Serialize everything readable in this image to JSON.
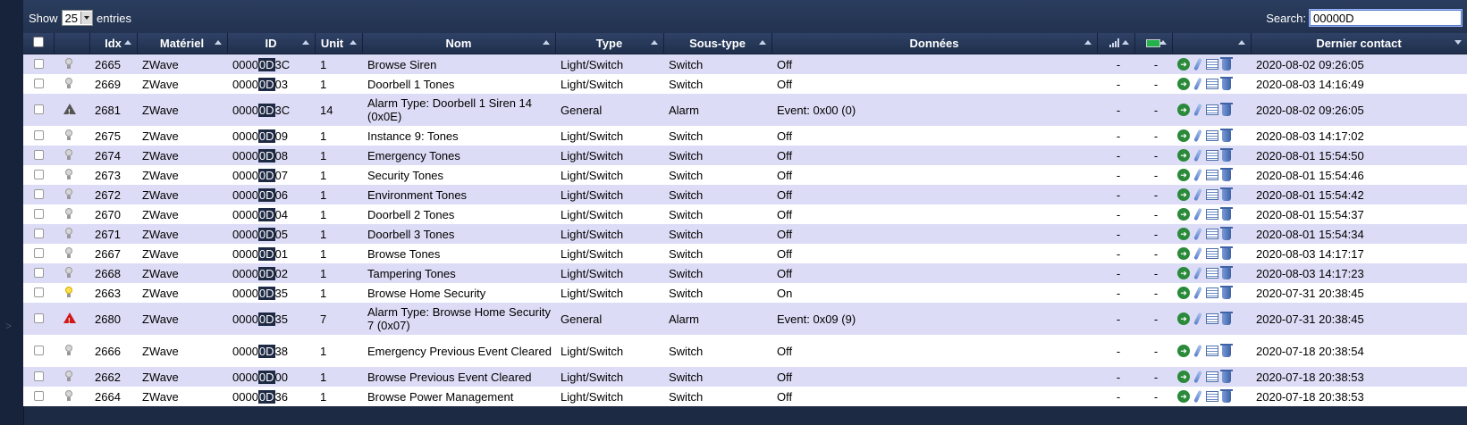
{
  "top": {
    "show_label": "Show",
    "entries_value": "25",
    "entries_label": "entries",
    "search_label": "Search:",
    "search_value": "00000D"
  },
  "columns": {
    "idx": "Idx",
    "materiel": "Matériel",
    "id": "ID",
    "unit": "Unit",
    "nom": "Nom",
    "type": "Type",
    "soustype": "Sous-type",
    "donnees": "Données",
    "dernier": "Dernier contact"
  },
  "rows": [
    {
      "idx": "2665",
      "hw": "ZWave",
      "id_pre": "0000",
      "id_hl": "0D",
      "id_post": "3C",
      "unit": "1",
      "nom": "Browse Siren",
      "type": "Light/Switch",
      "sub": "Switch",
      "data": "Off",
      "sig": "-",
      "bat": "-",
      "last": "2020-08-02 09:26:05",
      "icon": "bulb"
    },
    {
      "idx": "2669",
      "hw": "ZWave",
      "id_pre": "0000",
      "id_hl": "0D",
      "id_post": "03",
      "unit": "1",
      "nom": "Doorbell 1 Tones",
      "type": "Light/Switch",
      "sub": "Switch",
      "data": "Off",
      "sig": "-",
      "bat": "-",
      "last": "2020-08-03 14:16:49",
      "icon": "bulb"
    },
    {
      "idx": "2681",
      "hw": "ZWave",
      "id_pre": "0000",
      "id_hl": "0D",
      "id_post": "3C",
      "unit": "14",
      "nom": "Alarm Type: Doorbell 1 Siren 14 (0x0E)",
      "type": "General",
      "sub": "Alarm",
      "data": "Event: 0x00 (0)",
      "sig": "-",
      "bat": "-",
      "last": "2020-08-02 09:26:05",
      "icon": "alarm-grey"
    },
    {
      "idx": "2675",
      "hw": "ZWave",
      "id_pre": "0000",
      "id_hl": "0D",
      "id_post": "09",
      "unit": "1",
      "nom": "Instance 9: Tones",
      "type": "Light/Switch",
      "sub": "Switch",
      "data": "Off",
      "sig": "-",
      "bat": "-",
      "last": "2020-08-03 14:17:02",
      "icon": "bulb"
    },
    {
      "idx": "2674",
      "hw": "ZWave",
      "id_pre": "0000",
      "id_hl": "0D",
      "id_post": "08",
      "unit": "1",
      "nom": "Emergency Tones",
      "type": "Light/Switch",
      "sub": "Switch",
      "data": "Off",
      "sig": "-",
      "bat": "-",
      "last": "2020-08-01 15:54:50",
      "icon": "bulb"
    },
    {
      "idx": "2673",
      "hw": "ZWave",
      "id_pre": "0000",
      "id_hl": "0D",
      "id_post": "07",
      "unit": "1",
      "nom": "Security Tones",
      "type": "Light/Switch",
      "sub": "Switch",
      "data": "Off",
      "sig": "-",
      "bat": "-",
      "last": "2020-08-01 15:54:46",
      "icon": "bulb"
    },
    {
      "idx": "2672",
      "hw": "ZWave",
      "id_pre": "0000",
      "id_hl": "0D",
      "id_post": "06",
      "unit": "1",
      "nom": "Environment Tones",
      "type": "Light/Switch",
      "sub": "Switch",
      "data": "Off",
      "sig": "-",
      "bat": "-",
      "last": "2020-08-01 15:54:42",
      "icon": "bulb"
    },
    {
      "idx": "2670",
      "hw": "ZWave",
      "id_pre": "0000",
      "id_hl": "0D",
      "id_post": "04",
      "unit": "1",
      "nom": "Doorbell 2 Tones",
      "type": "Light/Switch",
      "sub": "Switch",
      "data": "Off",
      "sig": "-",
      "bat": "-",
      "last": "2020-08-01 15:54:37",
      "icon": "bulb"
    },
    {
      "idx": "2671",
      "hw": "ZWave",
      "id_pre": "0000",
      "id_hl": "0D",
      "id_post": "05",
      "unit": "1",
      "nom": "Doorbell 3 Tones",
      "type": "Light/Switch",
      "sub": "Switch",
      "data": "Off",
      "sig": "-",
      "bat": "-",
      "last": "2020-08-01 15:54:34",
      "icon": "bulb"
    },
    {
      "idx": "2667",
      "hw": "ZWave",
      "id_pre": "0000",
      "id_hl": "0D",
      "id_post": "01",
      "unit": "1",
      "nom": "Browse Tones",
      "type": "Light/Switch",
      "sub": "Switch",
      "data": "Off",
      "sig": "-",
      "bat": "-",
      "last": "2020-08-03 14:17:17",
      "icon": "bulb"
    },
    {
      "idx": "2668",
      "hw": "ZWave",
      "id_pre": "0000",
      "id_hl": "0D",
      "id_post": "02",
      "unit": "1",
      "nom": "Tampering Tones",
      "type": "Light/Switch",
      "sub": "Switch",
      "data": "Off",
      "sig": "-",
      "bat": "-",
      "last": "2020-08-03 14:17:23",
      "icon": "bulb"
    },
    {
      "idx": "2663",
      "hw": "ZWave",
      "id_pre": "0000",
      "id_hl": "0D",
      "id_post": "35",
      "unit": "1",
      "nom": "Browse Home Security",
      "type": "Light/Switch",
      "sub": "Switch",
      "data": "On",
      "sig": "-",
      "bat": "-",
      "last": "2020-07-31 20:38:45",
      "icon": "bulb-on"
    },
    {
      "idx": "2680",
      "hw": "ZWave",
      "id_pre": "0000",
      "id_hl": "0D",
      "id_post": "35",
      "unit": "7",
      "nom": "Alarm Type: Browse Home Security 7 (0x07)",
      "type": "General",
      "sub": "Alarm",
      "data": "Event: 0x09 (9)",
      "sig": "-",
      "bat": "-",
      "last": "2020-07-31 20:38:45",
      "icon": "alarm-red"
    },
    {
      "idx": "2666",
      "hw": "ZWave",
      "id_pre": "0000",
      "id_hl": "0D",
      "id_post": "38",
      "unit": "1",
      "nom": "Emergency Previous Event Cleared",
      "type": "Light/Switch",
      "sub": "Switch",
      "data": "Off",
      "sig": "-",
      "bat": "-",
      "last": "2020-07-18 20:38:54",
      "icon": "bulb"
    },
    {
      "idx": "2662",
      "hw": "ZWave",
      "id_pre": "0000",
      "id_hl": "0D",
      "id_post": "00",
      "unit": "1",
      "nom": "Browse Previous Event Cleared",
      "type": "Light/Switch",
      "sub": "Switch",
      "data": "Off",
      "sig": "-",
      "bat": "-",
      "last": "2020-07-18 20:38:53",
      "icon": "bulb"
    },
    {
      "idx": "2664",
      "hw": "ZWave",
      "id_pre": "0000",
      "id_hl": "0D",
      "id_post": "36",
      "unit": "1",
      "nom": "Browse Power Management",
      "type": "Light/Switch",
      "sub": "Switch",
      "data": "Off",
      "sig": "-",
      "bat": "-",
      "last": "2020-07-18 20:38:53",
      "icon": "bulb"
    }
  ]
}
